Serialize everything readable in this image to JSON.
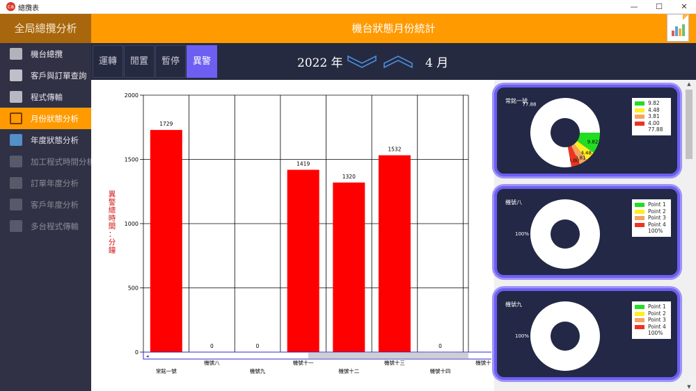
{
  "window": {
    "title": "總攬表",
    "app_icon_text": "ca",
    "minimize": "—",
    "maximize": "☐",
    "close": "✕"
  },
  "header": {
    "left_title": "全局總攬分析",
    "title": "機台狀態月份統計"
  },
  "sidebar": {
    "items": [
      {
        "label": "機台總攬",
        "state": "normal",
        "icon": "machine-icon"
      },
      {
        "label": "客戶與訂單查詢",
        "state": "normal",
        "icon": "document-search-icon"
      },
      {
        "label": "程式傳輸",
        "state": "normal",
        "icon": "transfer-icon"
      },
      {
        "label": "月份狀態分析",
        "state": "active",
        "icon": "monitor-icon"
      },
      {
        "label": "年度狀態分析",
        "state": "normal",
        "icon": "bar-chart-icon"
      },
      {
        "label": "加工程式時間分析",
        "state": "dim",
        "icon": "clock-icon"
      },
      {
        "label": "訂單年度分析",
        "state": "dim",
        "icon": "order-icon"
      },
      {
        "label": "客戶年度分析",
        "state": "dim",
        "icon": "customer-icon"
      },
      {
        "label": "多台程式傳輸",
        "state": "dim",
        "icon": "network-icon"
      }
    ]
  },
  "toolbar": {
    "tabs": [
      {
        "label": "運轉"
      },
      {
        "label": "閒置"
      },
      {
        "label": "暫停"
      },
      {
        "label": "異警"
      }
    ],
    "active_tab": 3,
    "year": "2022 年",
    "month": "4 月"
  },
  "chart_data": {
    "type": "bar",
    "ylabel": "異警總時間：分鐘",
    "ylim": [
      0,
      2000
    ],
    "yticks": [
      0,
      500,
      1000,
      1500,
      2000
    ],
    "categories": [
      "常銘一號",
      "機號八",
      "機號九",
      "機號十一",
      "機號十二",
      "機號十三",
      "機號十四",
      "機號十五"
    ],
    "values": [
      1729,
      0,
      0,
      1419,
      1320,
      1532,
      0,
      null
    ],
    "value_labels": [
      "1729",
      "0",
      "0",
      "1419",
      "1320",
      "1532",
      "0",
      ""
    ],
    "bar_color": "#ff0000",
    "grid": true
  },
  "pie_cards": [
    {
      "title": "常銘一號",
      "slices": [
        {
          "legend": "9.82",
          "label": "9.82",
          "value": 9.82,
          "color": "#22dd22"
        },
        {
          "legend": "4.48",
          "label": "4.48",
          "value": 4.48,
          "color": "#ffee22"
        },
        {
          "legend": "3.81",
          "label": "3.81",
          "value": 3.81,
          "color": "#f4a460"
        },
        {
          "legend": "4.00",
          "label": "4.00",
          "value": 4.0,
          "color": "#ee3322"
        },
        {
          "legend": "77.88",
          "label": "77.88",
          "value": 77.88,
          "color": "#ffffff"
        }
      ]
    },
    {
      "title": "機號八",
      "slices": [
        {
          "legend": "Point 1",
          "value": 0,
          "color": "#22dd22"
        },
        {
          "legend": "Point 2",
          "value": 0,
          "color": "#ffee22"
        },
        {
          "legend": "Point 3",
          "value": 0,
          "color": "#f4a460"
        },
        {
          "legend": "Point 4",
          "value": 0,
          "color": "#ee3322"
        },
        {
          "legend": "100%",
          "label": "100%",
          "value": 100,
          "color": "#ffffff"
        }
      ]
    },
    {
      "title": "機號九",
      "slices": [
        {
          "legend": "Point 1",
          "value": 0,
          "color": "#22dd22"
        },
        {
          "legend": "Point 2",
          "value": 0,
          "color": "#ffee22"
        },
        {
          "legend": "Point 3",
          "value": 0,
          "color": "#f4a460"
        },
        {
          "legend": "Point 4",
          "value": 0,
          "color": "#ee3322"
        },
        {
          "legend": "100%",
          "label": "100%",
          "value": 100,
          "color": "#ffffff"
        }
      ]
    }
  ],
  "colors": {
    "accent": "#ff9a00",
    "sidebar": "#303144",
    "toolbar": "#262a40",
    "tab_active": "#6c5ff2",
    "card_border": "#6c5ff2"
  }
}
